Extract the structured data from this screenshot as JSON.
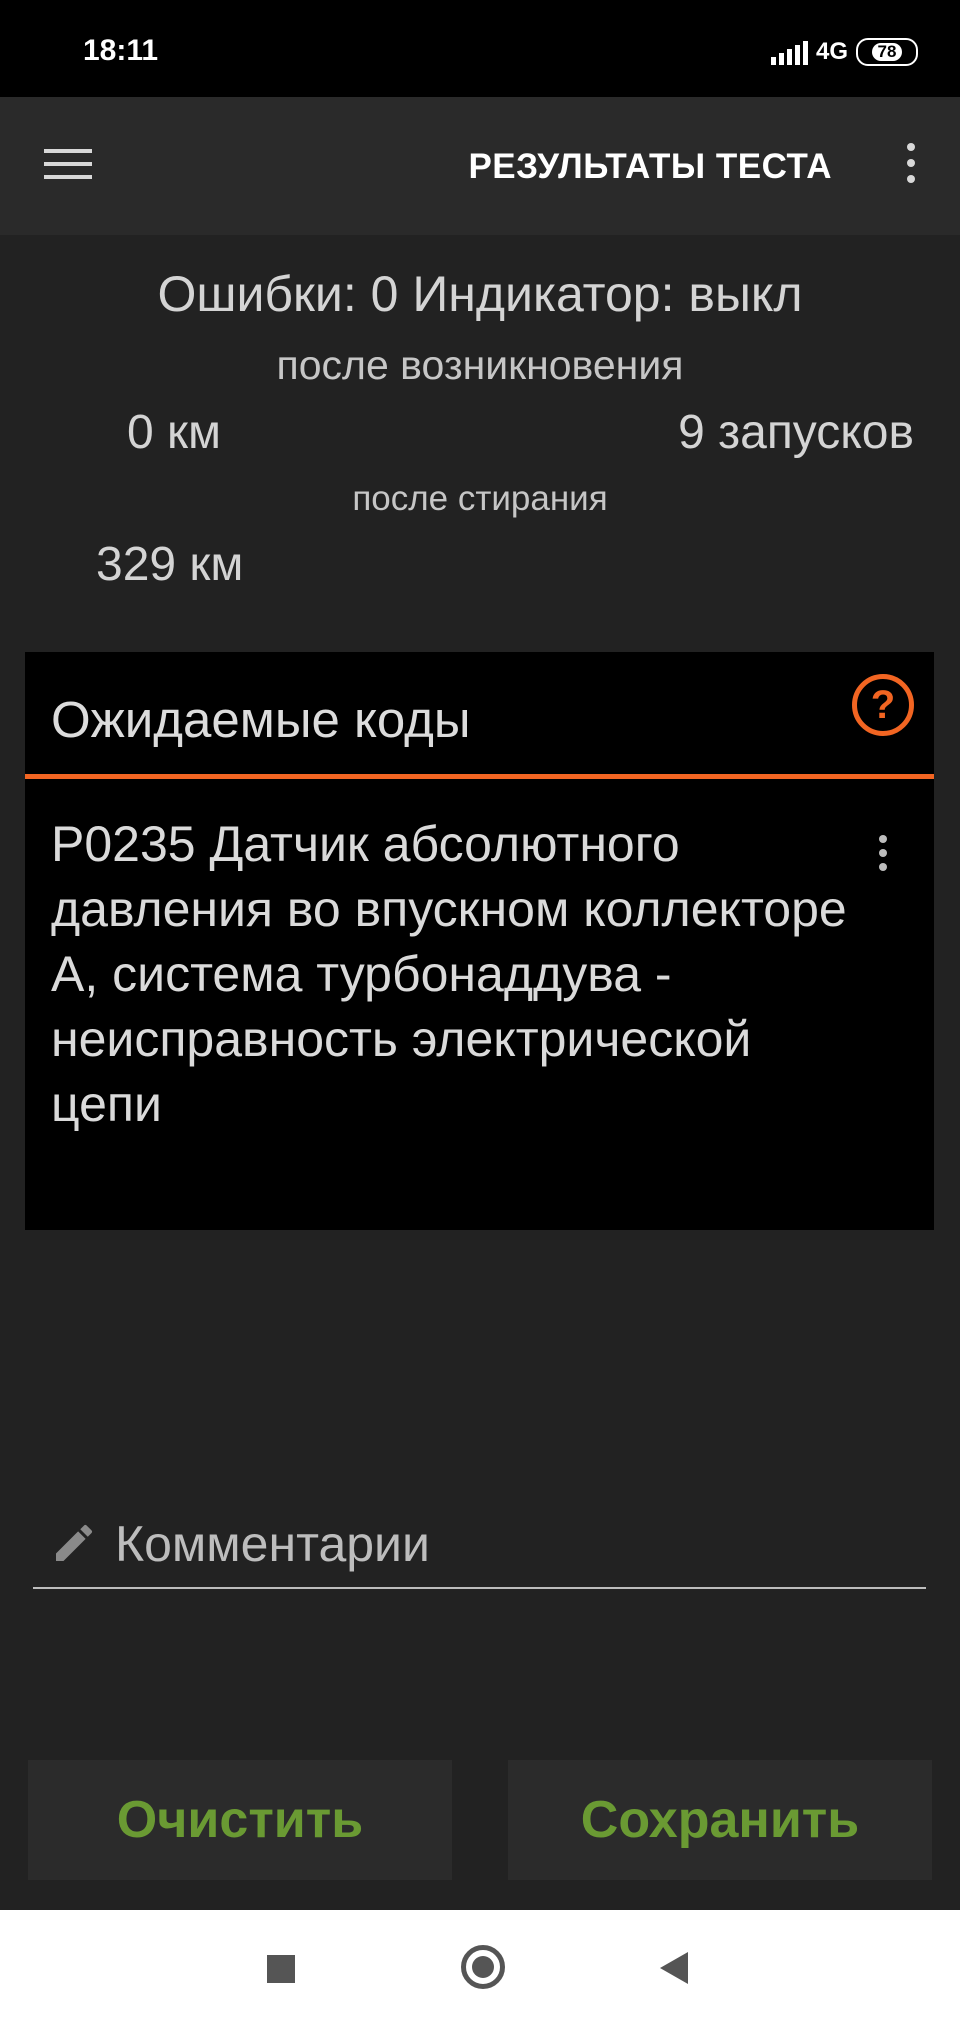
{
  "status_bar": {
    "time": "18:11",
    "network": "4G",
    "battery": "78"
  },
  "app_bar": {
    "title": "РЕЗУЛЬТАТЫ ТЕСТА",
    "menu_icon": "hamburger-menu-icon",
    "overflow_icon": "more-vert-icon"
  },
  "summary": {
    "errors_line": "Ошибки: 0 Индикатор: выкл",
    "after_occurrence_label": "после возникновения",
    "km_since_occurrence": "0 км",
    "starts": "9 запусков",
    "after_clear_label": "после стирания",
    "km_since_clear": "329 км"
  },
  "pending_codes": {
    "title": "Ожидаемые коды",
    "help_icon": "?",
    "accent_color": "#f26522",
    "items": [
      {
        "text": "P0235 Датчик абсолютного давления во впускном коллекторе A, система турбонаддува - неисправность электрической цепи"
      }
    ]
  },
  "comment_field": {
    "placeholder": "Комментарии",
    "icon": "pencil-icon"
  },
  "buttons": {
    "clear_label": "Очистить",
    "save_label": "Сохранить",
    "label_color": "#6a9a33"
  },
  "nav_bar": {
    "recent_icon": "square-recent-icon",
    "home_icon": "circle-home-icon",
    "back_icon": "triangle-back-icon"
  }
}
